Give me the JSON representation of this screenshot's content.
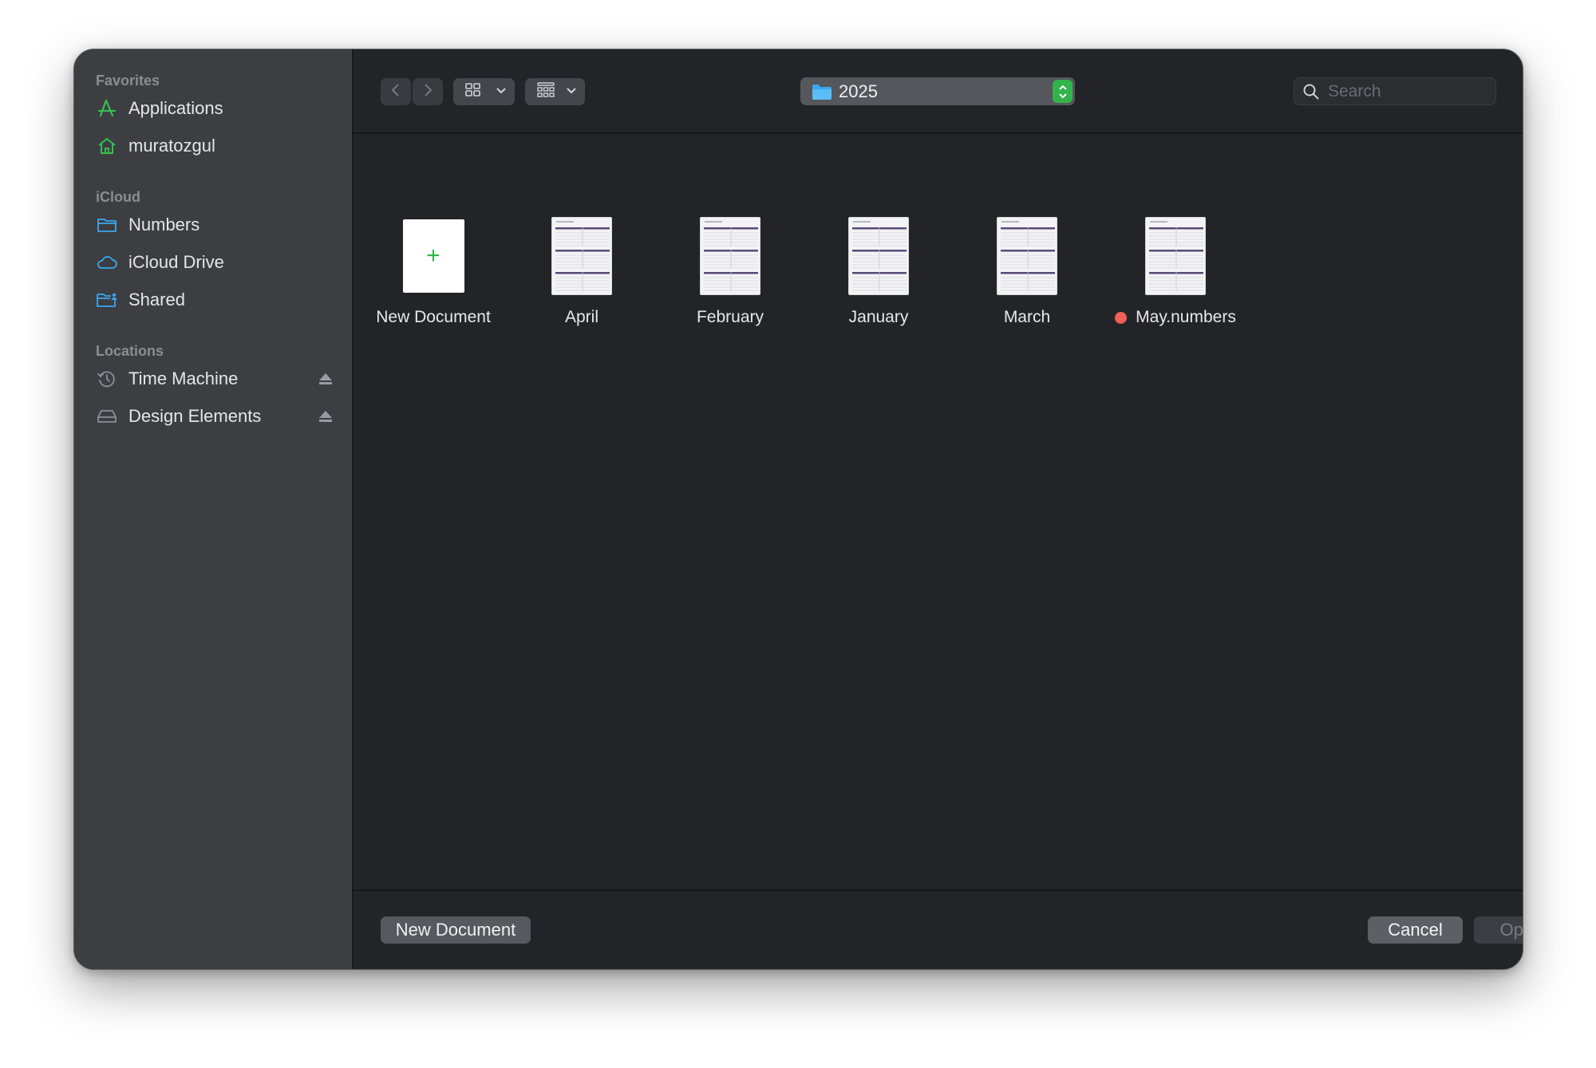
{
  "sidebar": {
    "favorites_title": "Favorites",
    "icloud_title": "iCloud",
    "locations_title": "Locations",
    "favorites": [
      {
        "label": "Applications",
        "icon": "applications-icon"
      },
      {
        "label": "muratozgul",
        "icon": "home-icon"
      }
    ],
    "icloud": [
      {
        "label": "Numbers",
        "icon": "folder-icon"
      },
      {
        "label": "iCloud Drive",
        "icon": "cloud-icon"
      },
      {
        "label": "Shared",
        "icon": "shared-folder-icon"
      }
    ],
    "locations": [
      {
        "label": "Time Machine",
        "icon": "time-machine-icon",
        "ejectable": true
      },
      {
        "label": "Design Elements",
        "icon": "drive-icon",
        "ejectable": true
      }
    ]
  },
  "toolbar": {
    "current_folder": "2025",
    "search_placeholder": "Search"
  },
  "files": [
    {
      "label": "New Document",
      "type": "new"
    },
    {
      "label": "April",
      "type": "spreadsheet"
    },
    {
      "label": "February",
      "type": "spreadsheet"
    },
    {
      "label": "January",
      "type": "spreadsheet"
    },
    {
      "label": "March",
      "type": "spreadsheet"
    },
    {
      "label": "May.numbers",
      "type": "spreadsheet",
      "tag_color": "#f25f58"
    }
  ],
  "footer": {
    "new_document_label": "New Document",
    "cancel_label": "Cancel",
    "open_label": "Open"
  },
  "colors": {
    "accent_green": "#32b44a",
    "sidebar_bg": "#3d3e42",
    "content_bg": "#222428",
    "red_tag": "#f25f58",
    "folder_blue": "#3aa8f0"
  }
}
